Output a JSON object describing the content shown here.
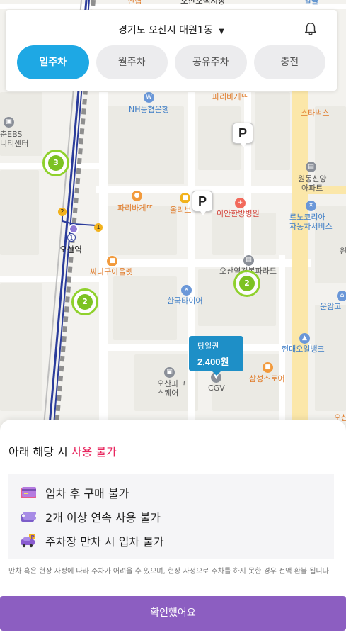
{
  "header": {
    "location": "경기도 오산시 대원1동",
    "caret_icon": "▼",
    "bell_icon": "bell-icon",
    "tabs": [
      {
        "label": "일주차",
        "active": true
      },
      {
        "label": "월주차",
        "active": false
      },
      {
        "label": "공유주차",
        "active": false
      },
      {
        "label": "충전",
        "active": false
      }
    ]
  },
  "map": {
    "labels": {
      "top_partial_1": "신협",
      "top_partial_2": "오산오색시장",
      "top_partial_3": "알뜰",
      "paris_1": "파리바게뜨",
      "starbucks": "스타벅스",
      "nh_bank": "NH농협은행",
      "ebs": "춘EBS\n니티센터",
      "wondong": "원동신양\n아파트",
      "paris_2": "파리바게뜨",
      "olive": "올리브",
      "ian_hospital": "이안한방병원",
      "renault": "르노코리아\n자동차서비스",
      "station": "오산역",
      "ssadagu": "싸다구아울렛",
      "osan_palace": "오산역경복파라드",
      "hankook_tire": "한국타이어",
      "unam": "운암고",
      "hyundai_oil": "현대오일뱅크",
      "osan_park": "오산파크\n스퀘어",
      "cgv": "CGV",
      "samsung_store": "삼성스토어",
      "right_partial_1": "원",
      "right_partial_2": "오산"
    },
    "clusters": [
      "3",
      "2",
      "2"
    ],
    "parking_markers": [
      "P",
      "P"
    ],
    "line_stops": [
      "2",
      "1",
      "1"
    ],
    "price_tag": {
      "type": "당일권",
      "price": "2,400원"
    }
  },
  "sheet": {
    "title_prefix": "아래 해당 시 ",
    "title_highlight": "사용 불가",
    "rules": [
      {
        "icon": "card-icon",
        "text": "입차 후 구매 불가"
      },
      {
        "icon": "tickets-icon",
        "text": "2개 이상 연속 사용 불가"
      },
      {
        "icon": "car-parking-icon",
        "text": "주차장 만차 시 입차 불가"
      }
    ],
    "notice": "만차 혹은 현장 사정에 따라 주차가 어려울 수 있으며, 현장 사정으로 주차를 하지 못한 경우 전액 환불 됩니다.",
    "confirm_label": "확인했어요"
  },
  "colors": {
    "accent": "#1ea8e4",
    "warning": "#e8265e",
    "confirm": "#8c5ec1",
    "cluster": "#7cc222",
    "price_tag": "#1e8fc7"
  }
}
